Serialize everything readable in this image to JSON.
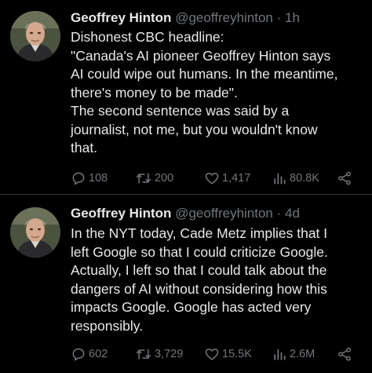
{
  "tweets": [
    {
      "author": "Geoffrey Hinton",
      "handle": "@geoffreyhinton",
      "separator": "·",
      "time": "1h",
      "lines": [
        "Dishonest CBC headline:",
        "\"Canada's AI pioneer Geoffrey Hinton says",
        "AI could wipe out humans. In the meantime,",
        "there's money to be made\".",
        "The second sentence was said by a",
        "journalist, not me, but you wouldn't know",
        "that."
      ],
      "stats": {
        "replies": "108",
        "retweets": "200",
        "likes": "1,417",
        "views": "80.8K"
      }
    },
    {
      "author": "Geoffrey Hinton",
      "handle": "@geoffreyhinton",
      "separator": "·",
      "time": "4d",
      "lines": [
        "In the NYT today, Cade Metz implies that I",
        "left Google so that I could criticize Google.",
        "Actually, I left so that I could talk about the",
        "dangers of AI without considering how this",
        "impacts Google. Google has acted very",
        "responsibly."
      ],
      "stats": {
        "replies": "602",
        "retweets": "3,729",
        "likes": "15.5K",
        "views": "2.6M"
      }
    }
  ],
  "icons": {
    "reply": "reply-icon",
    "retweet": "retweet-icon",
    "like": "heart-icon",
    "views": "views-icon",
    "share": "share-icon"
  },
  "colors": {
    "background": "#000000",
    "text": "#e7e9ea",
    "secondary": "#71767b",
    "divider": "#2f3336"
  }
}
